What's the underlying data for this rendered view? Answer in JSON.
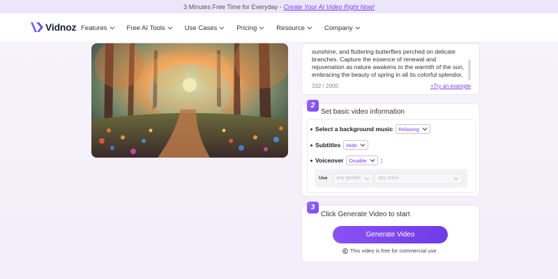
{
  "promo": {
    "text": "3 Minutes Free Time for Everyday -",
    "link": "Create Your AI Video Right Now!"
  },
  "nav": {
    "logo_text": "Vidnoz",
    "items": [
      "Features",
      "Free AI Tools",
      "Use Cases",
      "Pricing",
      "Resource",
      "Company"
    ]
  },
  "hero": {
    "image_alt": "Painted enchanted forest path with colorful flowers and glowing light"
  },
  "prompt": {
    "text": "sunshine, and fluttering butterflies perched on delicate branches. Capture the essence of renewal and rejuvenation as nature awakens to the warmth of the sun, embracing the beauty of spring in all its colorful splendor.",
    "counter": "332 / 2000",
    "try_example": "+Try an example"
  },
  "step2": {
    "number": "2",
    "title": "Set basic video information",
    "music_label": "Select a background music",
    "music_value": "Relaxing",
    "subtitles_label": "Subtitles",
    "subtitles_value": "Hide",
    "voiceover_label": "Voiceover",
    "voiceover_value": "Disable",
    "voiceover_colon": ":",
    "use_label": "Use",
    "gender_placeholder": "any gender",
    "voice_placeholder": "any voice"
  },
  "step3": {
    "number": "3",
    "title": "Click Generate Video to start",
    "button": "Generate Video",
    "note": "This video is free for commercial use."
  },
  "colors": {
    "accent": "#7b3ff2",
    "button": "#7d48ee",
    "promo_bg": "#ece6fb"
  }
}
